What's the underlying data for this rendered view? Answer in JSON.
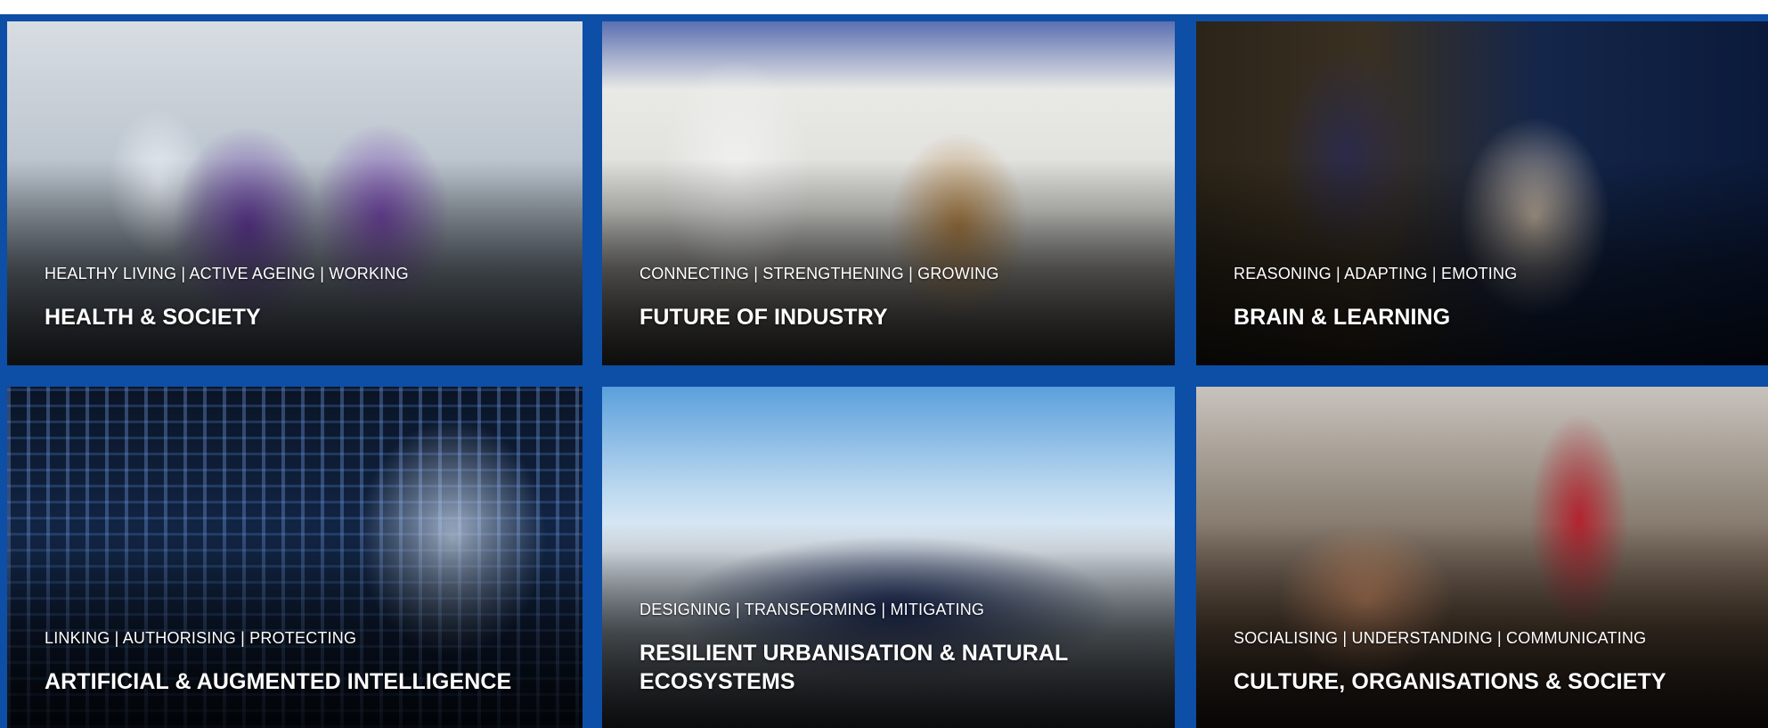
{
  "colors": {
    "frame_blue": "#0d4ea6",
    "caption_text": "#ffffff"
  },
  "tiles": [
    {
      "tags": "HEALTHY LIVING | ACTIVE AGEING | WORKING",
      "title": "HEALTH & SOCIETY"
    },
    {
      "tags": "CONNECTING | STRENGTHENING | GROWING",
      "title": "FUTURE OF INDUSTRY"
    },
    {
      "tags": "REASONING | ADAPTING | EMOTING",
      "title": "BRAIN & LEARNING"
    },
    {
      "tags": "LINKING | AUTHORISING | PROTECTING",
      "title": "ARTIFICIAL & AUGMENTED INTELLIGENCE"
    },
    {
      "tags": "DESIGNING | TRANSFORMING | MITIGATING",
      "title": "RESILIENT URBANISATION & NATURAL ECOSYSTEMS"
    },
    {
      "tags": "SOCIALISING | UNDERSTANDING | COMMUNICATING",
      "title": "CULTURE, ORGANISATIONS & SOCIETY"
    }
  ]
}
